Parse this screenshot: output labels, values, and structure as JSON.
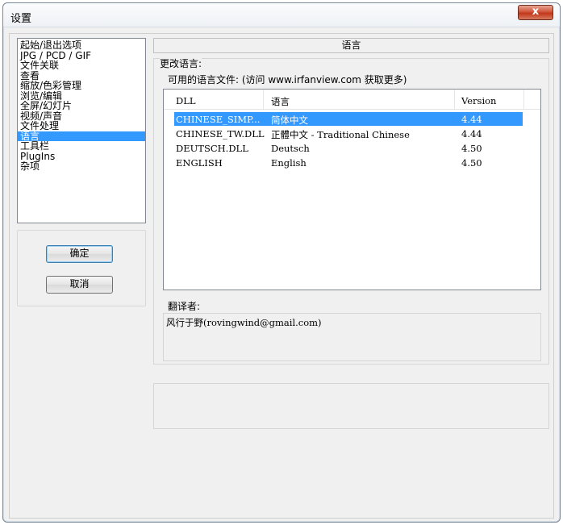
{
  "window": {
    "title": "设置",
    "close_label": "x"
  },
  "nav": {
    "items": [
      "起始/退出选项",
      "JPG / PCD / GIF",
      "文件关联",
      "查看",
      "缩放/色彩管理",
      "浏览/编辑",
      "全屏/幻灯片",
      "视频/声音",
      "文件处理",
      "语言",
      "工具栏",
      "PlugIns",
      "杂项"
    ],
    "selected_index": 9
  },
  "buttons": {
    "ok_label": "确定",
    "cancel_label": "取消"
  },
  "panel": {
    "header": "语言",
    "change_label": "更改语言:",
    "files_label": "可用的语言文件: (访问 www.irfanview.com 获取更多)"
  },
  "lang_table": {
    "columns": [
      "DLL",
      "语言",
      "Version"
    ],
    "rows": [
      [
        "CHINESE_SIMP...",
        "简体中文",
        "4.44"
      ],
      [
        "CHINESE_TW.DLL",
        "正體中文 - Traditional Chinese",
        "4.44"
      ],
      [
        "DEUTSCH.DLL",
        "Deutsch",
        "4.50"
      ],
      [
        "ENGLISH",
        "English",
        "4.50"
      ]
    ],
    "selected_row": 0
  },
  "translator": {
    "label": "翻译者:",
    "value": "风行于野(rovingwind@gmail.com)"
  },
  "colors": {
    "selection": "#3399ff",
    "dialog_bg": "#f0f0f0",
    "close_red": "#c4361a"
  }
}
